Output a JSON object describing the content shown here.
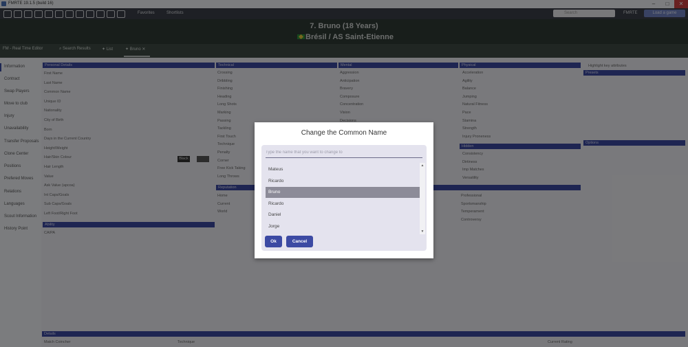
{
  "window": {
    "title": "FMRTE 19.1.5 (build 16)"
  },
  "toolbar": {
    "favorites": "Favorites",
    "shortlists": "Shortlists",
    "search_placeholder": "Search",
    "app_label": "FMRTE",
    "launch_label": "Load a game"
  },
  "player": {
    "title": "7. Bruno (18 Years)",
    "club": "Brésil / AS Saint-Etienne"
  },
  "tabs": [
    {
      "label": "FM - Real Time Editor"
    },
    {
      "label": "Search Results"
    },
    {
      "label": "List"
    },
    {
      "label": "Bruno"
    }
  ],
  "sidebar": {
    "items": [
      "Information",
      "Contract",
      "Swap Players",
      "Move to club",
      "Injury",
      "Unavailability",
      "Transfer Proposals",
      "Clone Center",
      "Positions",
      "Prefered Moves",
      "Relations",
      "Languages",
      "Scout Information",
      "History Point"
    ]
  },
  "personal": {
    "heading": "Personal Details",
    "rows": [
      "First Name",
      "Last Name",
      "Common Name",
      "Unique ID",
      "Nationality",
      "City of Birth",
      "Born",
      "Days in the Current Country",
      "Height/Weight",
      "Hair/Skin Colour",
      "Hair Length",
      "Value",
      "Ask Value (apcoa)",
      "Int Caps/Goals",
      "Sub Caps/Goals",
      "Left Foot/Right Foot"
    ],
    "hair_colour": "Black"
  },
  "ability": {
    "heading": "Ability",
    "row": "CA/PA"
  },
  "technical": {
    "heading": "Technical",
    "rows": [
      "Crossing",
      "Dribbling",
      "Finishing",
      "Heading",
      "Long Shots",
      "Marking",
      "Passing",
      "Tackling",
      "First Touch",
      "Technique",
      "Penalty",
      "Corner",
      "Free Kick Taking",
      "Long Throws"
    ]
  },
  "reputation": {
    "heading": "Reputation",
    "rows": [
      "Home",
      "Current",
      "World"
    ]
  },
  "mental": {
    "heading": "Mental",
    "rows": [
      "Aggression",
      "Anticipation",
      "Bravery",
      "Composure",
      "Concentration",
      "Vision",
      "Decisions"
    ]
  },
  "physical": {
    "heading": "Physical",
    "rows": [
      "Acceleration",
      "Agility",
      "Balance",
      "Jumping",
      "Natural Fitness",
      "Pace",
      "Stamina",
      "Strength",
      "Injury Proneness"
    ]
  },
  "hidden": {
    "heading": "Hidden",
    "rows": [
      "Consistency",
      "Dirtiness",
      "Imp Matches",
      "Versatility"
    ]
  },
  "personality": {
    "rows": [
      "Professional",
      "Sportsmanship",
      "Temperament",
      "Controversy"
    ]
  },
  "right_panel": {
    "highlight": "Highlight key attributes",
    "presets": "Presets",
    "options": "Options"
  },
  "bottom": {
    "heading": "Details",
    "match_coincher": "Match Coincher",
    "technique": "Technique",
    "current_rating": "Current Rating"
  },
  "dialog": {
    "title": "Change the Common Name",
    "input_placeholder": "Type the name that you want to change to",
    "options": [
      "Mateus",
      "Ricardo",
      "Bruno",
      "Ricardo",
      "Daniel",
      "Jorge"
    ],
    "selected_index": 2,
    "ok_label": "Ok",
    "cancel_label": "Cancel"
  }
}
